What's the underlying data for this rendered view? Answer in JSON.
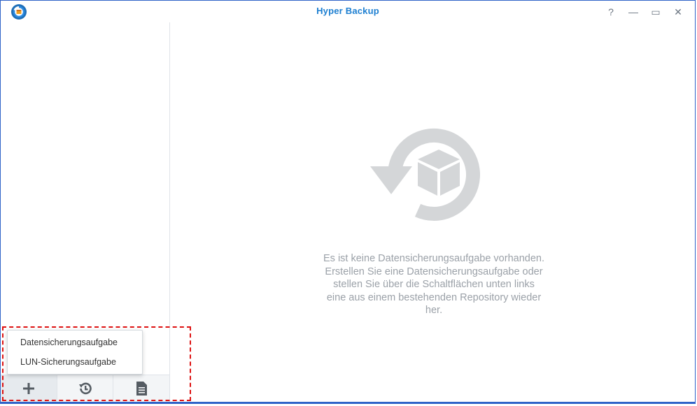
{
  "window": {
    "title": "Hyper Backup",
    "controls": {
      "help": "?",
      "minimize": "—",
      "maximize": "▭",
      "close": "✕"
    }
  },
  "main": {
    "empty_message": "Es ist keine Datensicherungsaufgabe vorhanden.\nErstellen Sie eine Datensicherungsaufgabe oder\nstellen Sie über die Schaltflächen unten links\neine aus einem bestehenden Repository wieder\nher."
  },
  "create_menu": {
    "items": [
      {
        "label": "Datensicherungsaufgabe"
      },
      {
        "label": "LUN-Sicherungsaufgabe"
      }
    ]
  },
  "sidebar_footer": {
    "buttons": [
      {
        "icon": "plus-icon"
      },
      {
        "icon": "restore-history-icon"
      },
      {
        "icon": "log-document-icon"
      }
    ]
  },
  "colors": {
    "accent": "#1d7fd1",
    "frame": "#2f63c8",
    "highlight": "#dd1111",
    "graphic": "#d4d6d8"
  }
}
